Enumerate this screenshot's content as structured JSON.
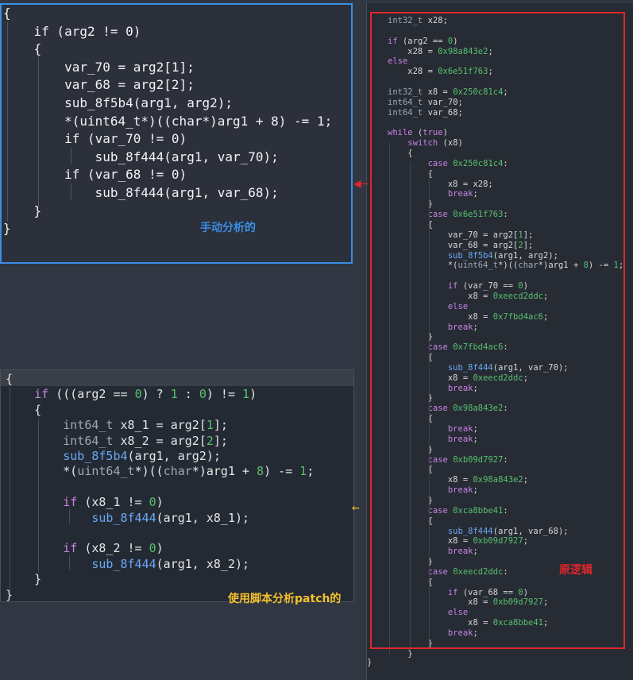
{
  "manual": {
    "label": "手动分析的",
    "lines": [
      "{",
      "    if (arg2 != 0)",
      "    {",
      "        var_70 = arg2[1];",
      "        var_68 = arg2[2];",
      "        sub_8f5b4(arg1, arg2);",
      "        *(uint64_t*)((char*)arg1 + 8) -= 1;",
      "        if (var_70 != 0)",
      "            sub_8f444(arg1, var_70);",
      "        if (var_68 != 0)",
      "            sub_8f444(arg1, var_68);",
      "    }",
      "}"
    ]
  },
  "patched": {
    "label": "使用脚本分析patch的",
    "lines": [
      "{",
      "    if (((arg2 == 0) ? 1 : 0) != 1)",
      "    {",
      "        int64_t x8_1 = arg2[1];",
      "        int64_t x8_2 = arg2[2];",
      "        sub_8f5b4(arg1, arg2);",
      "        *(uint64_t*)((char*)arg1 + 8) -= 1;",
      "",
      "        if (x8_1 != 0)",
      "            sub_8f444(arg1, x8_1);",
      "",
      "        if (x8_2 != 0)",
      "            sub_8f444(arg1, x8_2);",
      "    }",
      "}"
    ]
  },
  "original": {
    "label": "原逻辑",
    "lines": [
      "int32_t x28;",
      "",
      "if (arg2 == 0)",
      "    x28 = 0x98a843e2;",
      "else",
      "    x28 = 0x6e51f763;",
      "",
      "int32_t x8 = 0x250c81c4;",
      "int64_t var_70;",
      "int64_t var_68;",
      "",
      "while (true)",
      "    switch (x8)",
      "    {",
      "        case 0x250c81c4:",
      "        {",
      "            x8 = x28;",
      "            break;",
      "        }",
      "        case 0x6e51f763:",
      "        {",
      "            var_70 = arg2[1];",
      "            var_68 = arg2[2];",
      "            sub_8f5b4(arg1, arg2);",
      "            *(uint64_t*)((char*)arg1 + 8) -= 1;",
      "",
      "            if (var_70 == 0)",
      "                x8 = 0xeecd2ddc;",
      "            else",
      "                x8 = 0x7fbd4ac6;",
      "            break;",
      "        }",
      "        case 0x7fbd4ac6:",
      "        {",
      "            sub_8f444(arg1, var_70);",
      "            x8 = 0xeecd2ddc;",
      "            break;",
      "        }",
      "        case 0x98a843e2:",
      "        {",
      "            break;",
      "            break;",
      "        }",
      "        case 0xb09d7927:",
      "        {",
      "            x8 = 0x98a843e2;",
      "            break;",
      "        }",
      "        case 0xca8bbe41:",
      "        {",
      "            sub_8f444(arg1, var_68);",
      "            x8 = 0xb09d7927;",
      "            break;",
      "        }",
      "        case 0xeecd2ddc:",
      "        {",
      "            if (var_68 == 0)",
      "                x8 = 0xb09d7927;",
      "            else",
      "                x8 = 0xca8bbe41;",
      "            break;",
      "        }",
      "    }"
    ],
    "closing": "}"
  },
  "colors": {
    "manual_border": "#3a8ee6",
    "manual_label": "#3a8ee6",
    "original_border": "#e1262b",
    "original_label": "#e1262b",
    "patched_label": "#f2c12e",
    "arrow_red": "#e1262b",
    "arrow_yellow": "#f2c12e"
  },
  "icons": [
    "arrow-left-icon"
  ]
}
